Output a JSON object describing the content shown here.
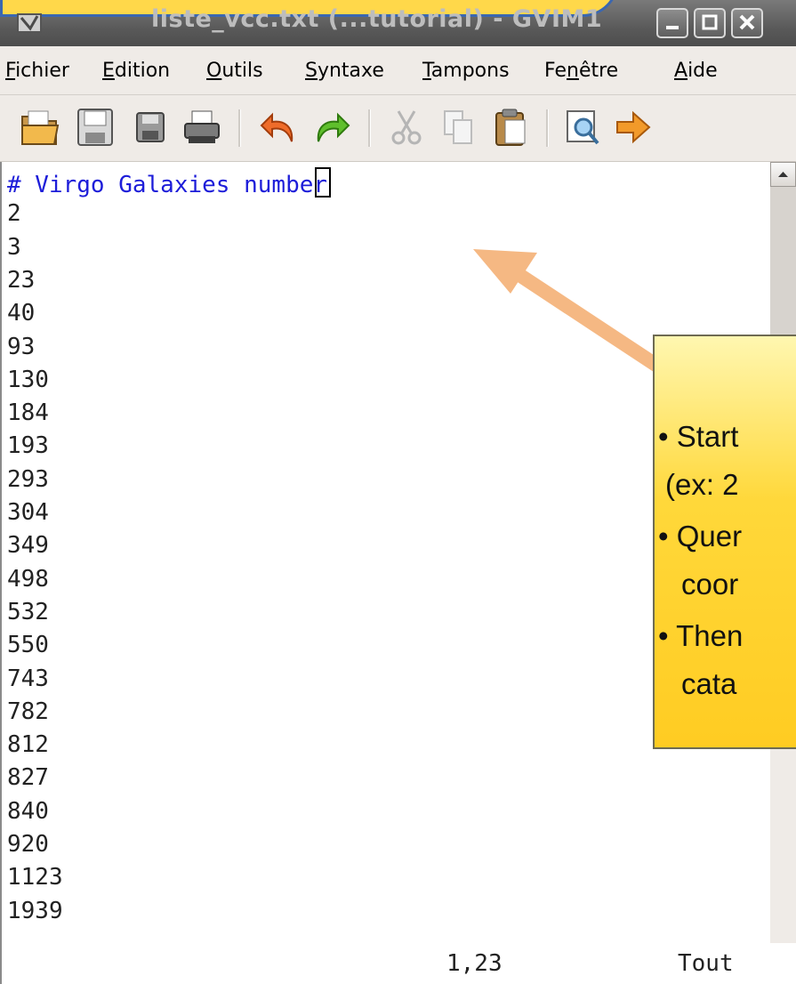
{
  "window": {
    "title": "liste_vcc.txt (...tutorial) - GVIM1"
  },
  "menu": [
    {
      "mnemonic": "F",
      "rest": "ichier"
    },
    {
      "mnemonic": "E",
      "rest": "dition"
    },
    {
      "mnemonic": "O",
      "rest": "utils"
    },
    {
      "mnemonic": "S",
      "rest": "yntaxe"
    },
    {
      "mnemonic": "T",
      "rest": "ampons"
    },
    {
      "pre": "Fe",
      "mnemonic": "n",
      "rest": "être"
    },
    {
      "mnemonic": "A",
      "rest": "ide"
    }
  ],
  "toolbar": {
    "icons": [
      "open-folder-icon",
      "save-icon",
      "save-all-icon",
      "print-icon",
      "undo-icon",
      "redo-icon",
      "cut-icon",
      "copy-icon",
      "paste-icon",
      "find-replace-icon",
      "next-arrow-icon"
    ]
  },
  "editor": {
    "comment_line": "# Virgo Galaxies numbe",
    "cursor_char": "r",
    "lines": [
      "2",
      "3",
      "23",
      "40",
      "93",
      "130",
      "184",
      "193",
      "293",
      "304",
      "349",
      "498",
      "532",
      "550",
      "743",
      "782",
      "812",
      "827",
      "840",
      "920",
      "1123",
      "1939"
    ]
  },
  "status": {
    "position": "1,23",
    "scroll": "Tout"
  },
  "callout": {
    "lines": [
      "• Start",
      "(ex: 2",
      "• Quer",
      "coor",
      "• Then",
      "cata"
    ]
  },
  "colors": {
    "comment": "#1d1dd9",
    "callout_fill": "#ffd83a",
    "arrow": "#f5b883"
  }
}
